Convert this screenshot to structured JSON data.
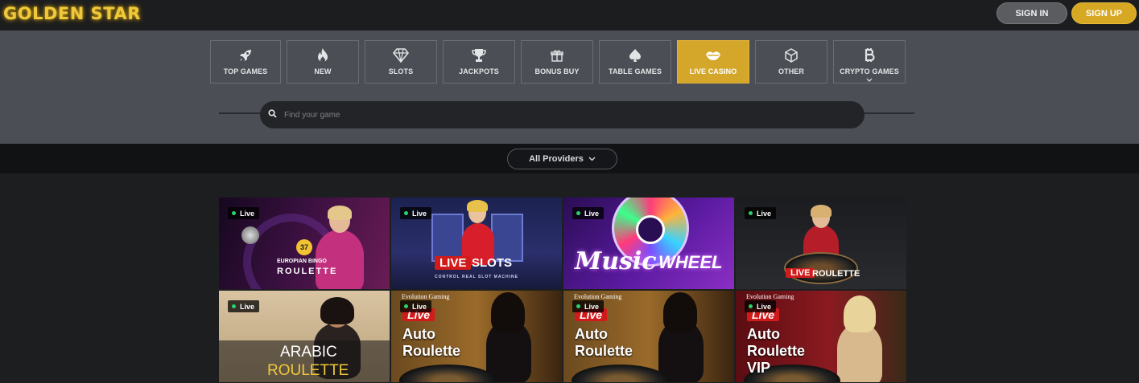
{
  "header": {
    "logo_text": "GOLDEN STAR",
    "signin_label": "SIGN IN",
    "signup_label": "SIGN UP"
  },
  "categories": [
    {
      "label": "TOP GAMES",
      "icon": "rocket-icon"
    },
    {
      "label": "NEW",
      "icon": "fire-icon"
    },
    {
      "label": "SLOTS",
      "icon": "diamond-icon"
    },
    {
      "label": "JACKPOTS",
      "icon": "trophy-icon"
    },
    {
      "label": "BONUS BUY",
      "icon": "gift-icon"
    },
    {
      "label": "TABLE GAMES",
      "icon": "spade-icon"
    },
    {
      "label": "LIVE CASINO",
      "icon": "lips-icon",
      "active": true
    },
    {
      "label": "OTHER",
      "icon": "cube-icon"
    },
    {
      "label": "CRYPTO GAMES",
      "icon": "bitcoin-icon"
    }
  ],
  "search": {
    "placeholder": "Find your game"
  },
  "providers": {
    "label": "All Providers"
  },
  "colors": {
    "accent": "#d4a72a",
    "live_dot": "#29d36a",
    "live_red": "#d11b1b"
  },
  "games": [
    {
      "badge": "Live",
      "title_top": "EUROPIAN BINGO",
      "title_main": "ROULETTE",
      "number": "37"
    },
    {
      "badge": "Live",
      "title_live": "LIVE",
      "title_main": "SLOTS",
      "subtitle": "CONTROL REAL SLOT MACHINE"
    },
    {
      "badge": "Live",
      "title_top": "Music",
      "title_main": "WHEEL"
    },
    {
      "badge": "Live",
      "title_live": "LIVE",
      "title_main": "ROULETTE"
    },
    {
      "badge": "Live",
      "title_top": "ARABIC",
      "title_main": "ROULETTE"
    },
    {
      "badge": "Live",
      "provider": "Evolution Gaming",
      "title_live": "Live",
      "title_main": "Auto",
      "title_sub": "Roulette"
    },
    {
      "badge": "Live",
      "provider": "Evolution Gaming",
      "title_live": "Live",
      "title_main": "Auto",
      "title_sub": "Roulette"
    },
    {
      "badge": "Live",
      "provider": "Evolution Gaming",
      "title_live": "Live",
      "title_main": "Auto",
      "title_sub": "Roulette",
      "title_extra": "VIP"
    }
  ]
}
